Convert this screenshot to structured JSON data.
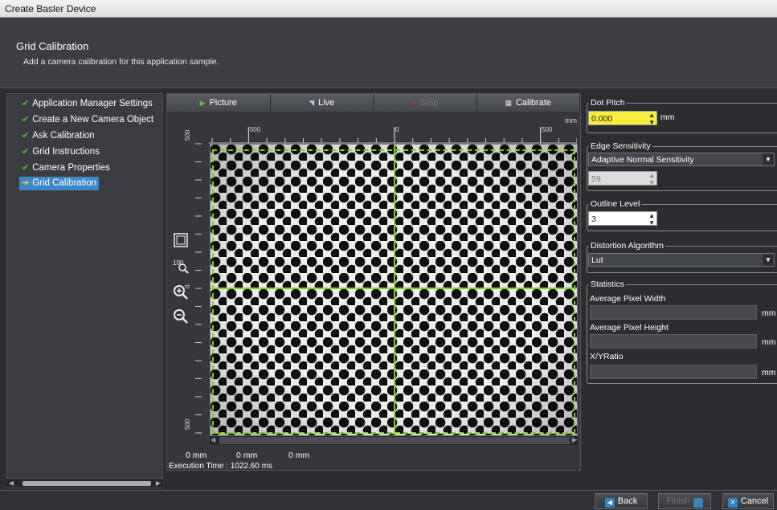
{
  "window": {
    "title": "Create Basler Device"
  },
  "header": {
    "title": "Grid Calibration",
    "subtitle": "Add a camera calibration for this application sample."
  },
  "steps": [
    {
      "label": "Application Manager Settings",
      "done": true
    },
    {
      "label": "Create a New Camera Object",
      "done": true
    },
    {
      "label": "Ask Calibration",
      "done": true
    },
    {
      "label": "Grid Instructions",
      "done": true
    },
    {
      "label": "Camera Properties",
      "done": true
    },
    {
      "label": "Grid Calibration",
      "active": true
    }
  ],
  "toolbar": {
    "picture": "Picture",
    "live": "Live",
    "stop": "Stop",
    "calibrate": "Calibrate"
  },
  "ruler": {
    "unit": "mm",
    "h_labels": [
      "-500",
      "0",
      "500"
    ],
    "v_labels": [
      "500",
      "0",
      "500"
    ]
  },
  "coords": {
    "x": "0 mm",
    "y": "0 mm",
    "z": "0 mm"
  },
  "execution": {
    "label": "Execution Time : 1022.60 ms"
  },
  "settings": {
    "dot_pitch": {
      "legend": "Dot Pitch",
      "value": "0.000",
      "unit": "mm"
    },
    "edge_sensitivity": {
      "legend": "Edge Sensitivity",
      "selected": "Adaptive Normal Sensitivity",
      "value": "59"
    },
    "outline_level": {
      "legend": "Outline Level",
      "value": "3"
    },
    "distortion": {
      "legend": "Distortion Algorithm",
      "selected": "Lut"
    }
  },
  "statistics": {
    "legend": "Statistics",
    "avg_width": {
      "label": "Average Pixel Width",
      "unit": "mm"
    },
    "avg_height": {
      "label": "Average Pixel Height",
      "unit": "mm"
    },
    "ratio": {
      "label": "X/YRatio",
      "unit": "mm"
    }
  },
  "footer": {
    "back": "Back",
    "finish": "Finish",
    "cancel": "Cancel"
  },
  "colors": {
    "accent": "#3f88c7",
    "check": "#5fbf3b",
    "crosshair": "#7ed321",
    "highlight_input": "#f5ee3c"
  }
}
